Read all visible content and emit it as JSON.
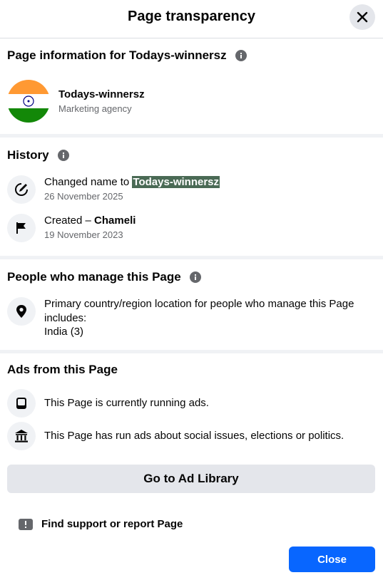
{
  "header": {
    "title": "Page transparency"
  },
  "page_info": {
    "title": "Page information for Todays-winnersz",
    "name": "Todays-winnersz",
    "category": "Marketing agency"
  },
  "history": {
    "title": "History",
    "items": [
      {
        "prefix": "Changed name to ",
        "value": "Todays-winnersz",
        "date": "26 November 2025"
      },
      {
        "prefix": "Created – ",
        "value": "Chameli",
        "date": "19 November 2023"
      }
    ]
  },
  "managers": {
    "title": "People who manage this Page",
    "description": "Primary country/region location for people who manage this Page includes:",
    "country": "India (3)"
  },
  "ads": {
    "title": "Ads from this Page",
    "running": "This Page is currently running ads.",
    "political": "This Page has run ads about social issues, elections or politics."
  },
  "buttons": {
    "ad_library": "Go to Ad Library",
    "support": "Find support or report Page",
    "close": "Close"
  },
  "colors": {
    "primary": "#0866ff",
    "highlight": "#4a6a55",
    "flag_saffron": "#ff9933",
    "flag_green": "#138808",
    "flag_chakra": "#000080"
  }
}
